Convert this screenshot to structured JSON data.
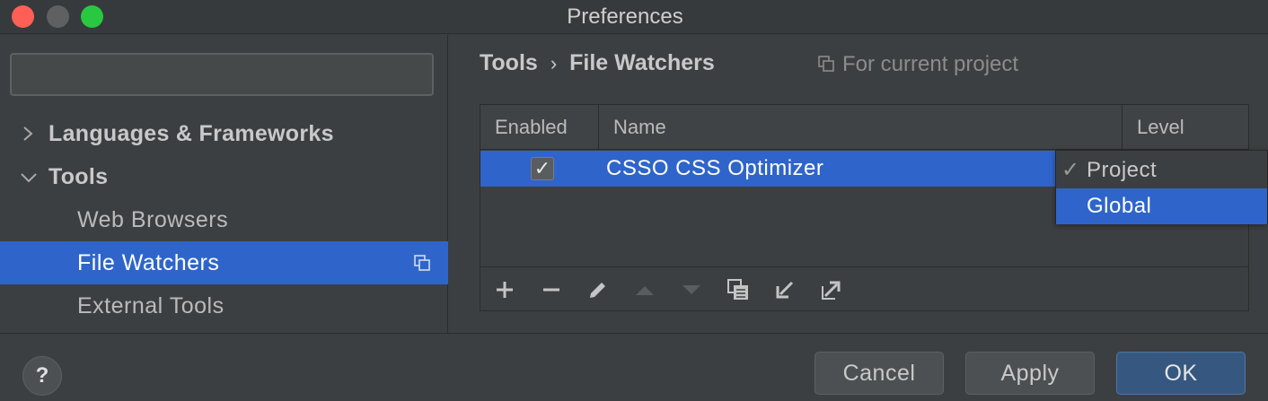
{
  "window": {
    "title": "Preferences"
  },
  "sidebar": {
    "search": {
      "value": "",
      "placeholder": ""
    },
    "items": [
      {
        "label": "Languages & Frameworks",
        "expanded": false
      },
      {
        "label": "Tools",
        "expanded": true
      },
      {
        "label": "Web Browsers"
      },
      {
        "label": "File Watchers",
        "selected": true,
        "icon": "copy-icon"
      },
      {
        "label": "External Tools"
      }
    ]
  },
  "breadcrumb": {
    "parent": "Tools",
    "separator": "›",
    "current": "File Watchers"
  },
  "scope": {
    "label": "For current project",
    "icon": "copy-icon"
  },
  "table": {
    "columns": [
      "Enabled",
      "Name",
      "Level"
    ],
    "rows": [
      {
        "enabled": true,
        "check": "✓",
        "name": "CSSO CSS Optimizer"
      }
    ]
  },
  "level_popup": {
    "options": [
      {
        "label": "Project",
        "check": "✓"
      },
      {
        "label": "Global",
        "check": ""
      }
    ]
  },
  "toolbar": {
    "icons": [
      "add-icon",
      "remove-icon",
      "edit-icon",
      "move-up-icon",
      "move-down-icon",
      "copy-icon",
      "import-icon",
      "export-icon"
    ]
  },
  "footer": {
    "help_label": "?",
    "cancel_label": "Cancel",
    "apply_label": "Apply",
    "ok_label": "OK"
  },
  "colors": {
    "background": "#3c3f41",
    "selection": "#2f65ca",
    "ok_button": "#365880",
    "close_light": "#ff5f57",
    "maximize_light": "#28c840"
  }
}
